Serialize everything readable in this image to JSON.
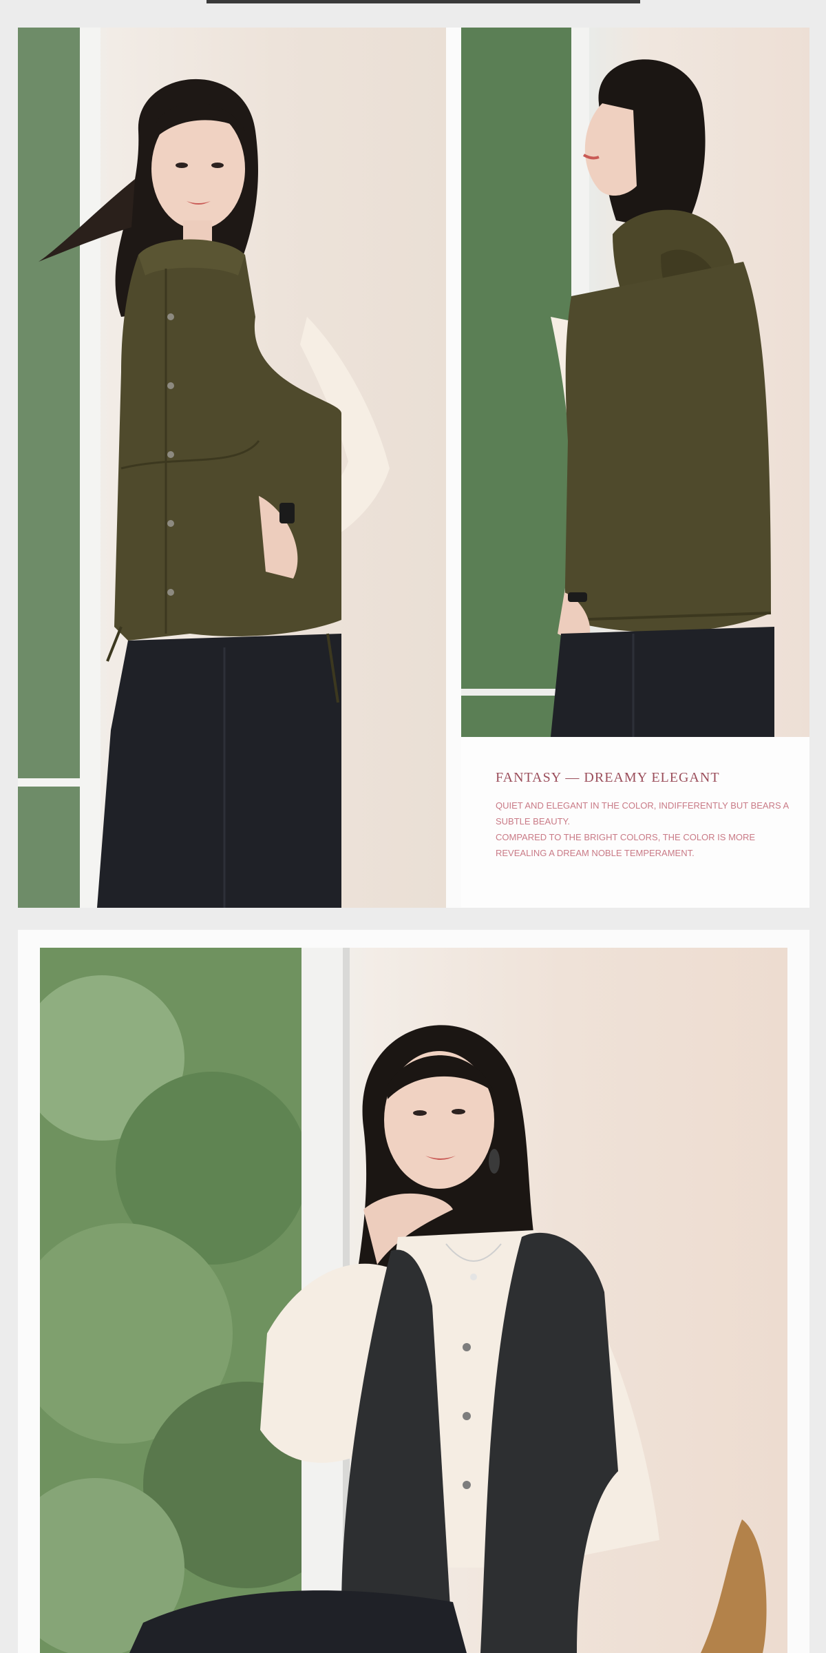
{
  "panel": {
    "title": "FANTASY — DREAMY  ELEGANT",
    "lines": [
      "QUIET AND ELEGANT IN THE COLOR, INDIFFERENTLY BUT BEARS A SUBTLE BEAUTY.",
      "COMPARED TO THE BRIGHT COLORS, THE COLOR IS MORE REVEALING A DREAM NOBLE TEMPERAMENT."
    ]
  },
  "colors": {
    "accent_title": "#9b4e5b",
    "accent_body": "#c97a86",
    "vest_green": "#4f4a2c",
    "vest_charcoal": "#2d2f31",
    "pants_dark": "#1f2127"
  },
  "icons": [
    "vest-photo-front",
    "vest-photo-back",
    "vest-photo-seated"
  ]
}
